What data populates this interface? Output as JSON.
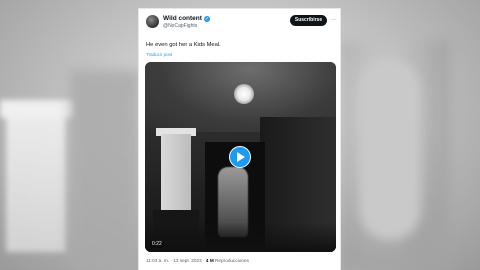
{
  "author": {
    "name": "Wild content",
    "handle": "@NoCapFights",
    "verified": true
  },
  "subscribe_label": "Suscribirse",
  "more_label": "···",
  "tweet": {
    "text": "He even got her a Kids Meal.",
    "translate_label": "Traducir post"
  },
  "video": {
    "duration": "0:22",
    "play_icon": "play-icon"
  },
  "meta": {
    "time": "11:03 a. m.",
    "separator": "·",
    "date": "13 sept. 2023",
    "views_count": "4 M",
    "views_label": "Reproducciones"
  },
  "colors": {
    "accent": "#1d9bf0",
    "text_primary": "#0f1419",
    "text_secondary": "#536471"
  }
}
